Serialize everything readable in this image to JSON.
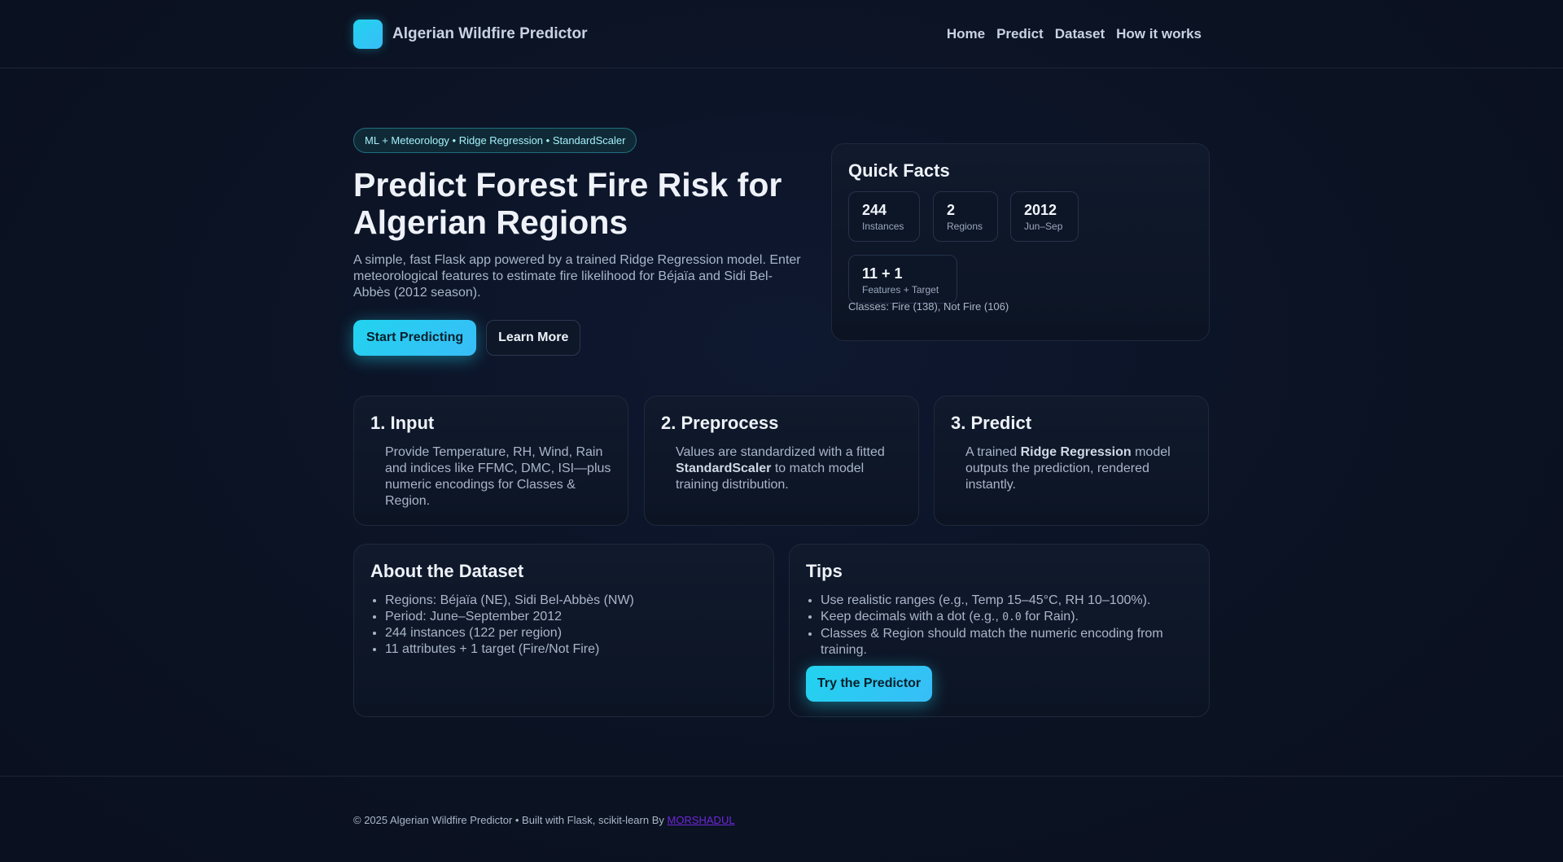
{
  "header": {
    "brand": "Algerian Wildfire Predictor",
    "nav": [
      "Home",
      "Predict",
      "Dataset",
      "How it works"
    ]
  },
  "hero": {
    "pill": "ML + Meteorology • Ridge Regression • StandardScaler",
    "title_line1": "Predict Forest Fire Risk for",
    "title_line2": "Algerian Regions",
    "description": "A simple, fast Flask app powered by a trained Ridge Regression model. Enter meteorological features to estimate fire likelihood for Béjaïa and Sidi Bel-Abbès (2012 season).",
    "primary_button": "Start Predicting",
    "secondary_button": "Learn More"
  },
  "quick_facts": {
    "title": "Quick Facts",
    "stats": [
      {
        "value": "244",
        "label": "Instances"
      },
      {
        "value": "2",
        "label": "Regions"
      },
      {
        "value": "2012",
        "label": "Jun–Sep"
      },
      {
        "value": "11 + 1",
        "label": "Features + Target"
      }
    ],
    "note": "Classes: Fire (138), Not Fire (106)"
  },
  "steps": [
    {
      "title": "1. Input",
      "text": "Provide Temperature, RH, Wind, Rain and indices like FFMC, DMC, ISI—plus numeric encodings for Classes & Region."
    },
    {
      "title": "2. Preprocess",
      "pre": "Values are standardized with a fitted ",
      "bold": "StandardScaler",
      "post": " to match model training distribution."
    },
    {
      "title": "3. Predict",
      "pre": "A trained ",
      "bold": "Ridge Regression",
      "post": " model outputs the prediction, rendered instantly."
    }
  ],
  "dataset": {
    "title": "About the Dataset",
    "items": [
      "Regions: Béjaïa (NE), Sidi Bel-Abbès (NW)",
      "Period: June–September 2012",
      "244 instances (122 per region)",
      "11 attributes + 1 target (Fire/Not Fire)"
    ]
  },
  "tips": {
    "title": "Tips",
    "item1": "Use realistic ranges (e.g., Temp 15–45°C, RH 10–100%).",
    "item2_pre": "Keep decimals with a dot (e.g., ",
    "item2_code": "0.0",
    "item2_post": " for Rain).",
    "item3": "Classes & Region should match the numeric encoding from training.",
    "button": "Try the Predictor"
  },
  "footer": {
    "text": "© 2025 Algerian Wildfire Predictor • Built with Flask, scikit-learn By ",
    "link": "MORSHADUL"
  },
  "colors": {
    "background": "#0b1222",
    "accent": "#22d3ee",
    "link": "#6d28d9"
  }
}
